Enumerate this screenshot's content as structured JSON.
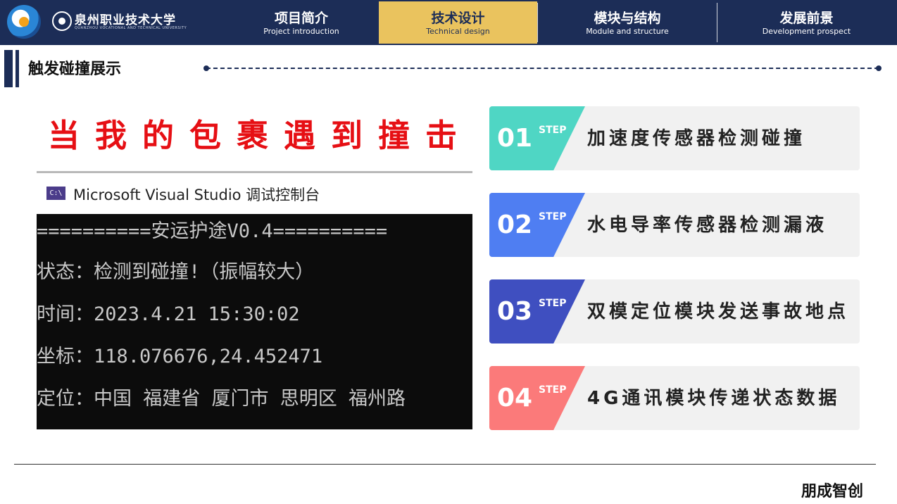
{
  "header": {
    "university_name": "泉州职业技术大学",
    "university_en": "QUANZHOU VOCATIONAL AND TECHNICAL UNIVERSITY",
    "nav": [
      {
        "cn": "项目简介",
        "en": "Project introduction",
        "active": false
      },
      {
        "cn": "技术设计",
        "en": "Technical design",
        "active": true
      },
      {
        "cn": "模块与结构",
        "en": "Module and structure",
        "active": false
      },
      {
        "cn": "发展前景",
        "en": "Development prospect",
        "active": false
      }
    ]
  },
  "section": {
    "title": "触发碰撞展示"
  },
  "headline": "当我的包裹遇到撞击",
  "console": {
    "icon_text": "C:\\",
    "title": "Microsoft Visual Studio 调试控制台",
    "lines": [
      "==========安运护途V0.4==========",
      "状态：检测到碰撞!（振幅较大）",
      "时间：2023.4.21 15:30:02",
      "坐标：118.076676,24.452471",
      "定位：中国 福建省 厦门市 思明区 福州路"
    ]
  },
  "steps": [
    {
      "num": "01",
      "label": "STEP",
      "text": "加速度传感器检测碰撞",
      "color": "#4fd6c4"
    },
    {
      "num": "02",
      "label": "STEP",
      "text": "水电导率传感器检测漏液",
      "color": "#4f7ef2"
    },
    {
      "num": "03",
      "label": "STEP",
      "text": "双模定位模块发送事故地点",
      "color": "#3f4fc0"
    },
    {
      "num": "04",
      "label": "STEP",
      "text": "4G通讯模块传递状态数据",
      "color": "#fb7a7a"
    }
  ],
  "footer": {
    "brand": "朋成智创"
  }
}
